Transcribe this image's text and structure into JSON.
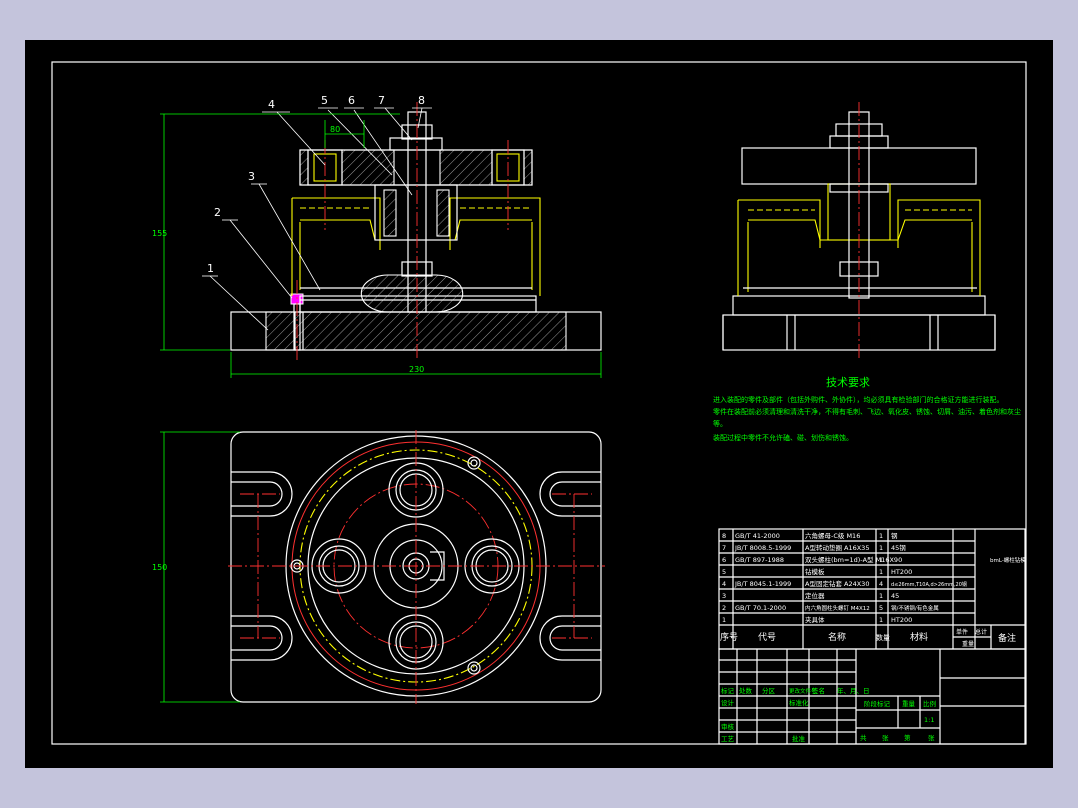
{
  "drawing": {
    "balloons": [
      "1",
      "2",
      "3",
      "4",
      "5",
      "6",
      "7",
      "8"
    ],
    "dims": {
      "width_front": "230",
      "height_front": "155",
      "width_top_inner": "80",
      "height_top": "150"
    },
    "tech_title": "技术要求",
    "tech_lines": [
      "进入装配的零件及部件（包括外购件、外协件），均必须具有检验部门的合格证方能进行装配。",
      "零件在装配前必须清理和清洗干净，不得有毛刺、飞边、氧化皮、锈蚀、切屑、油污、着色剂和灰尘",
      "等。",
      "装配过程中零件不允许磕、碰、划伤和锈蚀。"
    ]
  },
  "bom": {
    "rows": [
      {
        "no": "8",
        "code": "GB/T 41-2000",
        "name": "六角螺母-C级 M16",
        "qty": "1",
        "material": "钢"
      },
      {
        "no": "7",
        "code": "JB/T 8008.5-1999",
        "name": "A型转动垫圈 A16X35",
        "qty": "1",
        "material": "45钢"
      },
      {
        "no": "6",
        "code": "GB/T 897-1988",
        "name": "双头螺柱(bm=1d)-A型 M16X90",
        "qty": "1",
        "material": ""
      },
      {
        "no": "5",
        "code": "",
        "name": "钻模板",
        "qty": "1",
        "material": "HT200"
      },
      {
        "no": "4",
        "code": "JB/T 8045.1-1999",
        "name": "A型固定钻套 A24X30",
        "qty": "4",
        "material": "d≤26mm,T10A,d>26mm,20钢"
      },
      {
        "no": "3",
        "code": "",
        "name": "定位器",
        "qty": "1",
        "material": "45"
      },
      {
        "no": "2",
        "code": "GB/T 70.1-2000",
        "name": "内六角圆柱头螺钉 M4X12",
        "qty": "5",
        "material": "钢/不锈钢/有色金属"
      },
      {
        "no": "1",
        "code": "",
        "name": "夹具体",
        "qty": "1",
        "material": "HT200"
      }
    ],
    "header": {
      "no": "序号",
      "code": "代号",
      "name": "名称",
      "qty": "数量",
      "material": "材料",
      "unit": "单件",
      "total": "总计",
      "weight": "重量",
      "remark": "备注"
    },
    "side_note": "bmL-螺柱钻模"
  },
  "title_block": {
    "change_row": [
      "标记",
      "处数",
      "分区",
      "更改文件号",
      "签名",
      "年、月、日"
    ],
    "design": "设计",
    "standard": "标准化",
    "review": "审核",
    "process": "工艺",
    "approve": "批准",
    "stage": "阶段标记",
    "weight": "重量",
    "scale": "比例",
    "scale_value": "1:1",
    "sheets": [
      "共",
      "张",
      "第",
      "张"
    ]
  }
}
